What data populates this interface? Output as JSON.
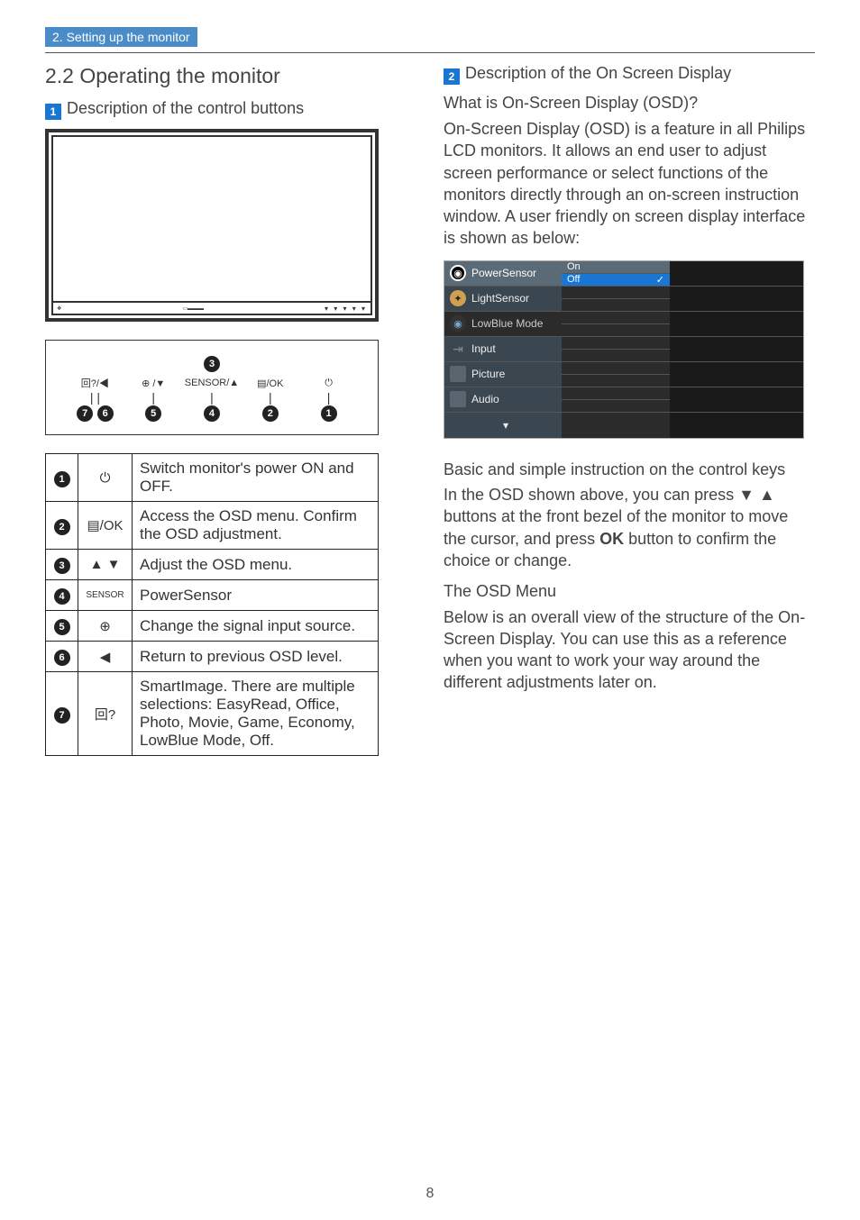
{
  "header": "2. Setting up the monitor",
  "left": {
    "title": "2.2 Operating the monitor",
    "sub1_num": "1",
    "sub1": "Description of the control buttons",
    "callout_labels": [
      "回⁠?/◀",
      "⊕ /▼",
      "SENSOR/▲",
      "▤/OK",
      "⏻"
    ],
    "callout_nums_top": "3",
    "callout_nums_bottom": [
      [
        "7",
        "6"
      ],
      [
        "5"
      ],
      [
        "4"
      ],
      [
        "2"
      ],
      [
        "1"
      ]
    ],
    "table": [
      {
        "n": "1",
        "icon": "⏻",
        "desc": "Switch monitor's power ON and OFF."
      },
      {
        "n": "2",
        "icon": "▤/OK",
        "desc": "Access the OSD menu. Confirm the OSD adjustment."
      },
      {
        "n": "3",
        "icon": "▲ ▼",
        "desc": "Adjust the OSD menu."
      },
      {
        "n": "4",
        "icon": "SENSOR",
        "desc": "PowerSensor"
      },
      {
        "n": "5",
        "icon": "⊕",
        "desc": "Change the signal input source."
      },
      {
        "n": "6",
        "icon": "◀",
        "desc": "Return to previous OSD level."
      },
      {
        "n": "7",
        "icon": "回?",
        "desc": "SmartImage. There are multiple selections: EasyRead, Office, Photo, Movie, Game, Economy, LowBlue Mode, Off."
      }
    ]
  },
  "right": {
    "sub2_num": "2",
    "sub2": "Description of the On Screen Display",
    "q": "What is On-Screen Display (OSD)?",
    "p1": "On-Screen Display (OSD) is a feature in all Philips LCD monitors. It allows an end user to adjust screen performance or select functions of the monitors directly through an on-screen instruction window. A user friendly on screen display interface is shown as below:",
    "osd": {
      "items": [
        {
          "label": "PowerSensor",
          "icon": "●",
          "cls": "ps",
          "mid": [
            "On",
            "Off"
          ],
          "sel": 1
        },
        {
          "label": "LightSensor",
          "icon": "💡",
          "cls": "bulb"
        },
        {
          "label": "LowBlue Mode",
          "icon": "👁",
          "cls": "eye"
        },
        {
          "label": "Input",
          "icon": "→",
          "cls": "arrow"
        },
        {
          "label": "Picture",
          "icon": "",
          "cls": "plain"
        },
        {
          "label": "Audio",
          "icon": "",
          "cls": "plain"
        },
        {
          "label": "▾",
          "icon": "",
          "cls": "none",
          "center": true
        }
      ]
    },
    "p2_title": "Basic and simple instruction on the control keys",
    "p2": "In the OSD shown above, you can press ▼ ▲ buttons at the front bezel of the monitor to move the cursor, and press OK button to confirm the choice or change.",
    "p3_title": "The OSD Menu",
    "p3": "Below is an overall view of the structure of the On-Screen Display. You can use this as a reference when you want to work your way around the different adjustments later on."
  },
  "page": "8"
}
